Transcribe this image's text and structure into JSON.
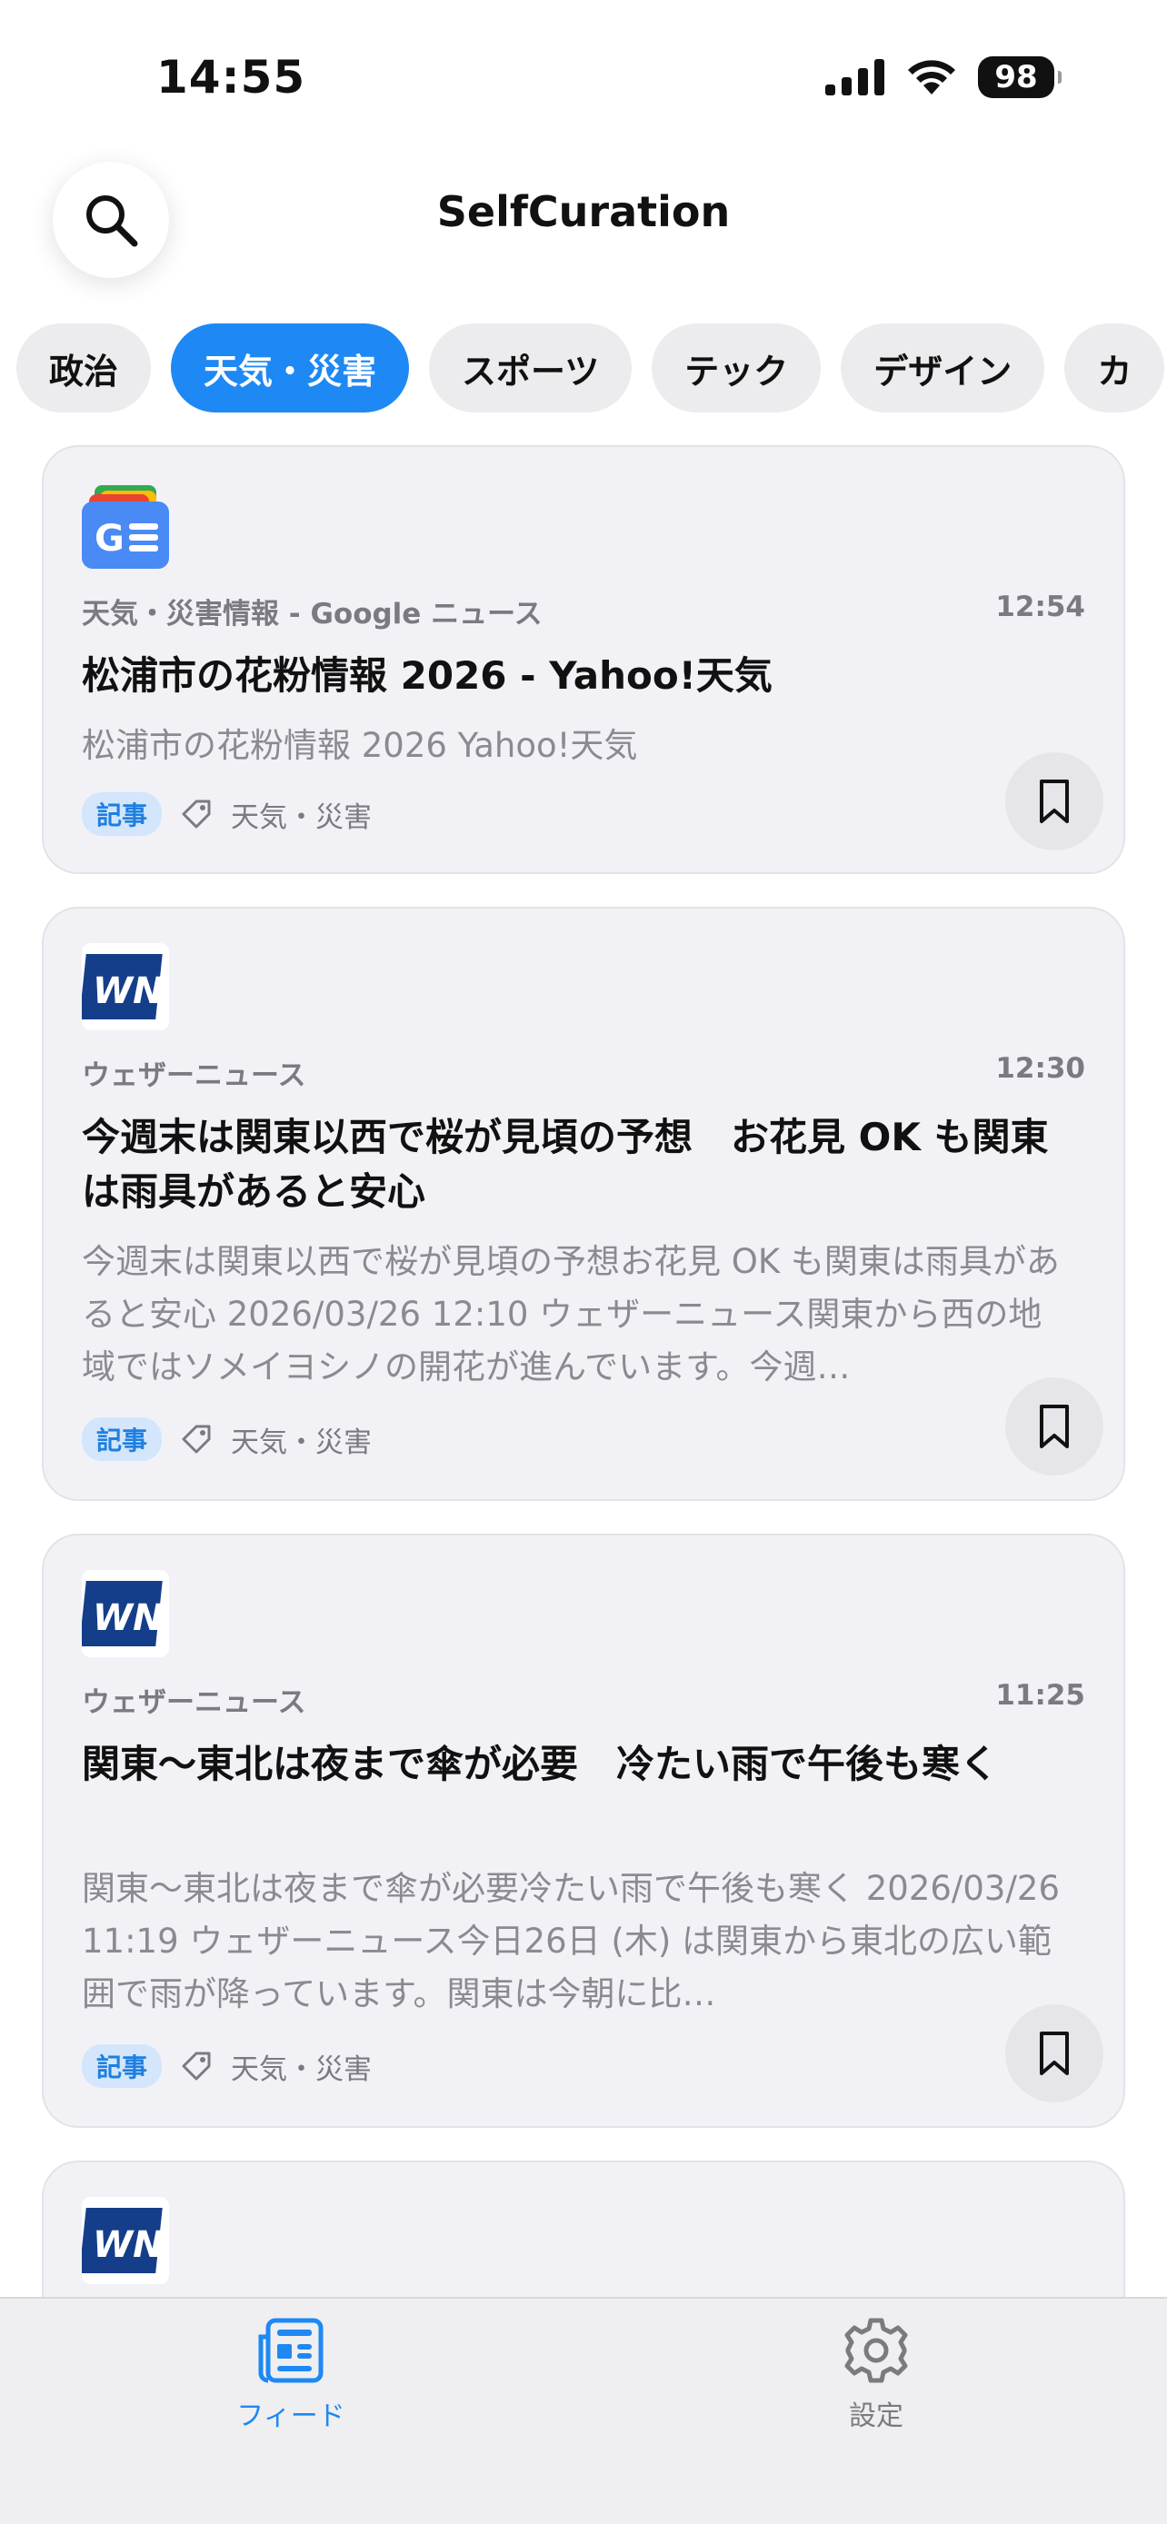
{
  "status": {
    "time": "14:55",
    "battery": "98"
  },
  "header": {
    "title": "SelfCuration"
  },
  "chips": [
    {
      "label": "政治",
      "active": false
    },
    {
      "label": "天気・災害",
      "active": true
    },
    {
      "label": "スポーツ",
      "active": false
    },
    {
      "label": "テック",
      "active": false
    },
    {
      "label": "デザイン",
      "active": false
    },
    {
      "label": "カ",
      "active": false
    }
  ],
  "cards": [
    {
      "logo": "google-news-icon",
      "source": "天気・災害情報 - Google ニュース",
      "time": "12:54",
      "title": "松浦市の花粉情報 2026 - Yahoo!天気",
      "summary": "松浦市の花粉情報 2026  Yahoo!天気",
      "badge": "記事",
      "tag": "天気・災害"
    },
    {
      "logo": "weathernews-icon",
      "source": "ウェザーニュース",
      "time": "12:30",
      "title": "今週末は関東以西で桜が見頃の予想　お花見 OK も関東は雨具があると安心",
      "summary": "今週末は関東以西で桜が見頃の予想お花見 OK も関東は雨具があると安心 2026/03/26 12:10 ウェザーニュース関東から西の地域ではソメイヨシノの開花が進んでいます。今週…",
      "badge": "記事",
      "tag": "天気・災害"
    },
    {
      "logo": "weathernews-icon",
      "source": "ウェザーニュース",
      "time": "11:25",
      "title": "関東〜東北は夜まで傘が必要　冷たい雨で午後も寒く",
      "summary": "関東〜東北は夜まで傘が必要冷たい雨で午後も寒く 2026/03/26 11:19 ウェザーニュース今日26日 (木) は関東から東北の広い範囲で雨が降っています。関東は今朝に比…",
      "badge": "記事",
      "tag": "天気・災害"
    },
    {
      "logo": "weathernews-icon"
    }
  ],
  "tabbar": {
    "feed_label": "フィード",
    "settings_label": "設定"
  },
  "colors": {
    "accent": "#1e88f5",
    "card_bg": "#f2f2f6",
    "badge_bg": "#d3e6fb"
  }
}
